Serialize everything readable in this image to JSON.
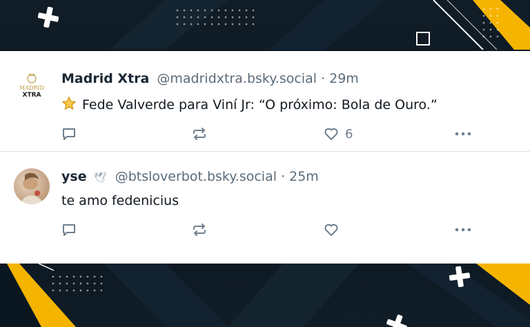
{
  "posts": [
    {
      "author": "Madrid Xtra",
      "handle": "@madridxtra.bsky.social",
      "time": "· 29m",
      "avatar_logo_line1": "MADRID",
      "avatar_logo_line2": "XTRA",
      "text": "Fede Valverde para Viní Jr: “O próximo: Bola de Ouro.”",
      "like_count": "6",
      "emoji_icon": "star-icon"
    },
    {
      "author": "yse",
      "handle": "@btsloverbot.bsky.social",
      "time": "· 25m",
      "badge_icon": "dove-icon",
      "text": "te amo fedenicius",
      "like_count": ""
    }
  ],
  "colors": {
    "accent_yellow": "#f5b400",
    "text_primary": "#101820",
    "text_muted": "#5b6b7a",
    "icon_muted": "#6f7f8e",
    "background_dark": "#0d1a24"
  }
}
